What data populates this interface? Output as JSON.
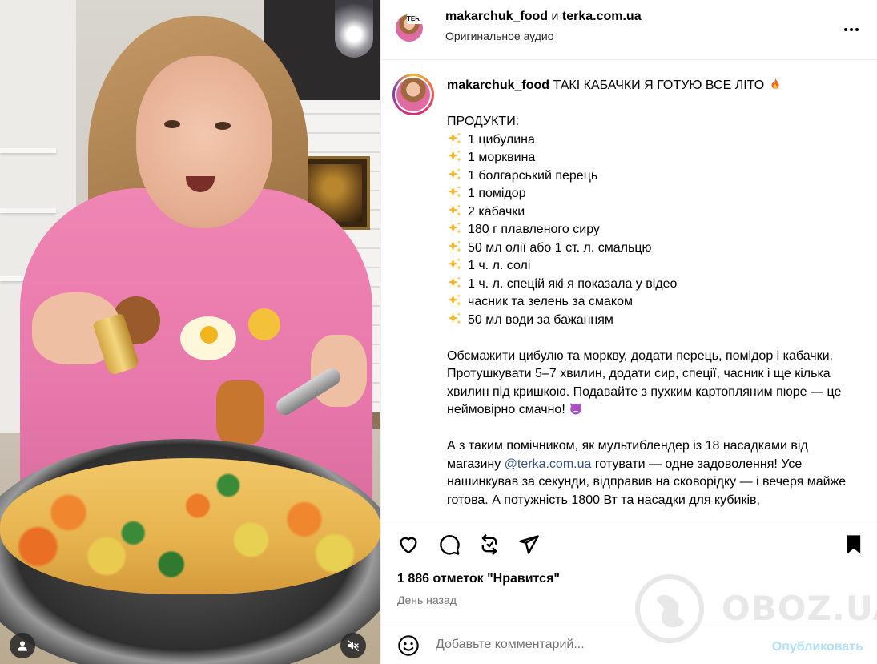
{
  "header": {
    "author": "makarchuk_food",
    "conjunction": "и",
    "collaborator": "terka.com.ua",
    "audio": "Оригинальное аудио",
    "avatar_tag": "TERKA"
  },
  "caption": {
    "username": "makarchuk_food",
    "title": "ТАКІ КАБАЧКИ Я ГОТУЮ ВСЕ ЛІТО",
    "title_emoji_icon": "fire-icon",
    "products_heading": "ПРОДУКТИ:",
    "bullet_icon": "sparkles-icon",
    "ingredients": [
      "1 цибулина",
      "1 морквина",
      "1 болгарський перець",
      "1 помідор",
      "2 кабачки",
      "180 г плавленого сиру",
      "50 мл олії або 1 ст. л. смальцю",
      "1 ч. л. солі",
      "1 ч. л. спецій які я показала у відео",
      "часник та зелень за смаком",
      "50 мл води за бажанням"
    ],
    "instructions": "Обсмажити цибулю та моркву, додати перець, помідор і кабачки. Протушкувати 5–7 хвилин, додати сир, спеції, часник і ще кілька хвилин під кришкою. Подавайте з пухким картопляним пюре — це неймовірно смачно!",
    "instructions_emoji_icon": "heart-eyes-devil-icon",
    "promo_before": "А з таким помічником, як мультиблендер із 18 насадками від магазину ",
    "promo_mention": "@terka.com.ua",
    "promo_after": " готувати — одне задоволення! Усе нашинкував за секунди, відправив на сковорідку — і вечеря майже готова. А потужність 1800 Вт та насадки для кубиків,"
  },
  "actions": {
    "like_icon": "heart-icon",
    "comment_icon": "comment-icon",
    "repost_icon": "repost-icon",
    "share_icon": "send-icon",
    "save_icon": "bookmark-icon"
  },
  "likes": "1 886 отметок \"Нравится\"",
  "time_ago": "День назад",
  "comment": {
    "placeholder": "Добавьте комментарий...",
    "value": "",
    "publish_label": "Опубликовать"
  },
  "watermark": "OBOZ.UA",
  "colors": {
    "link": "#385185",
    "publish_disabled": "#b2dffc",
    "muted_text": "#737373",
    "divider": "#efefef"
  }
}
